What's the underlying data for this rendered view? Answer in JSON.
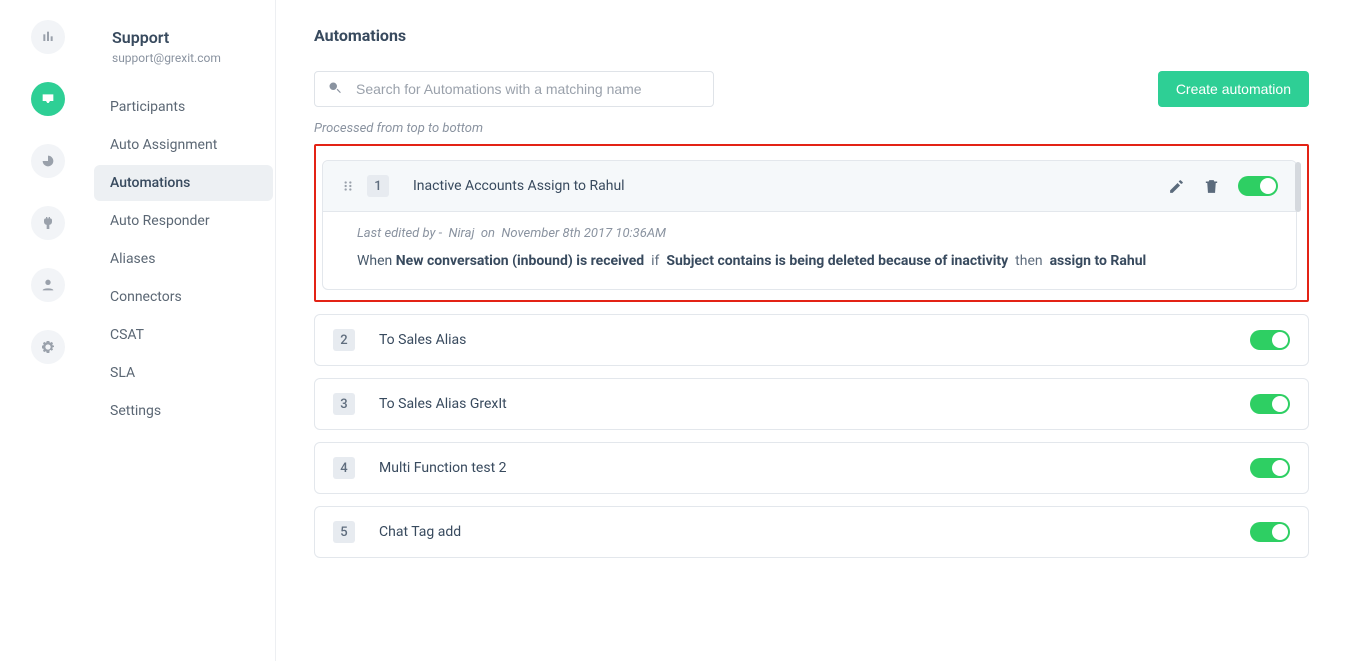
{
  "sidebar_header": {
    "title": "Support",
    "subtitle": "support@grexit.com"
  },
  "sidebar_items": [
    "Participants",
    "Auto Assignment",
    "Automations",
    "Auto Responder",
    "Aliases",
    "Connectors",
    "CSAT",
    "SLA",
    "Settings"
  ],
  "sidebar_active_index": 2,
  "page_title": "Automations",
  "search_placeholder": "Search for Automations with a matching name",
  "create_button": "Create automation",
  "process_note": "Processed from top to bottom",
  "automations": [
    {
      "num": "1",
      "title": "Inactive Accounts Assign to Rahul",
      "last_edited_by": "Niraj",
      "last_edited_on": "November 8th 2017 10:36AM",
      "rule_when": "When",
      "rule_trigger": "New conversation (inbound) is received",
      "rule_if": "if",
      "rule_cond": "Subject contains is being deleted because of inactivity",
      "rule_then": "then",
      "rule_action": "assign to Rahul"
    },
    {
      "num": "2",
      "title": "To Sales Alias"
    },
    {
      "num": "3",
      "title": "To Sales Alias GrexIt"
    },
    {
      "num": "4",
      "title": "Multi Function test 2"
    },
    {
      "num": "5",
      "title": "Chat Tag add"
    }
  ],
  "labels": {
    "last_edited_prefix": "Last edited by -",
    "on": "on"
  }
}
